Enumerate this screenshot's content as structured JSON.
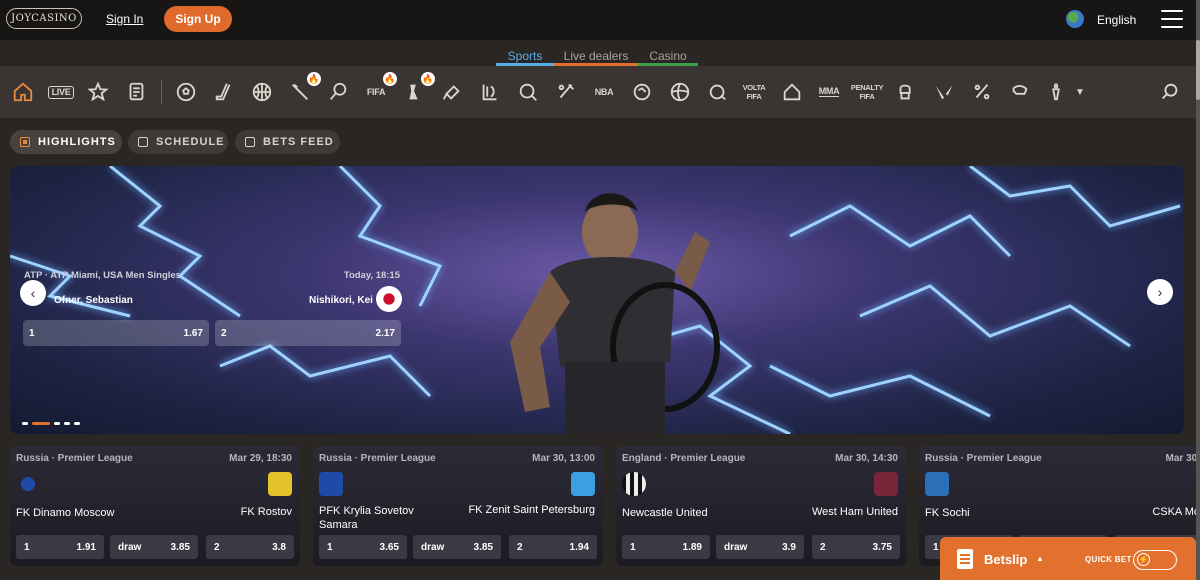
{
  "header": {
    "logo_text": "JOYCASINO",
    "signin_label": "Sign In",
    "signup_label": "Sign Up",
    "language": "English"
  },
  "nav_tabs": [
    {
      "label": "Sports",
      "active": true,
      "color": "#5aaee6"
    },
    {
      "label": "Live dealers",
      "active": false,
      "color": "#e0702c"
    },
    {
      "label": "Casino",
      "active": false,
      "color": "#3aa04a"
    }
  ],
  "sports_icons": {
    "live": "LIVE",
    "fifa1": "FIFA",
    "nba": "NBA",
    "volta": "VOLTA FIFA",
    "mma": "MMA",
    "penalty": "PENALTY FIFA"
  },
  "filters": [
    {
      "label": "HIGHLIGHTS",
      "active": true
    },
    {
      "label": "SCHEDULE",
      "active": false
    },
    {
      "label": "BETS FEED",
      "active": false
    }
  ],
  "featured": {
    "tournament": "ATP · ATP Miami, USA Men Singles",
    "time": "Today, 18:15",
    "player1": "Ofner, Sebastian",
    "player2": "Nishikori, Kei",
    "odd1_label": "1",
    "odd1_value": "1.67",
    "odd2_label": "2",
    "odd2_value": "2.17"
  },
  "matches": [
    {
      "league": "Russia · Premier League",
      "date": "Mar 29, 18:30",
      "team1": "FK Dinamo Moscow",
      "team2": "FK Rostov",
      "odds": [
        {
          "l": "1",
          "v": "1.91"
        },
        {
          "l": "draw",
          "v": "3.85"
        },
        {
          "l": "2",
          "v": "3.8"
        }
      ]
    },
    {
      "league": "Russia · Premier League",
      "date": "Mar 30, 13:00",
      "team1": "PFK Krylia Sovetov Samara",
      "team2": "FK Zenit Saint Petersburg",
      "odds": [
        {
          "l": "1",
          "v": "3.65"
        },
        {
          "l": "draw",
          "v": "3.85"
        },
        {
          "l": "2",
          "v": "1.94"
        }
      ]
    },
    {
      "league": "England · Premier League",
      "date": "Mar 30, 14:30",
      "team1": "Newcastle United",
      "team2": "West Ham United",
      "odds": [
        {
          "l": "1",
          "v": "1.89"
        },
        {
          "l": "draw",
          "v": "3.9"
        },
        {
          "l": "2",
          "v": "3.75"
        }
      ]
    },
    {
      "league": "Russia · Premier League",
      "date": "Mar 30,",
      "team1": "FK Sochi",
      "team2": "CSKA Mo",
      "odds": [
        {
          "l": "1",
          "v": ""
        },
        {
          "l": "",
          "v": ""
        },
        {
          "l": "",
          "v": ""
        }
      ]
    }
  ],
  "betslip": {
    "label": "Betslip",
    "quickbet_label": "QUICK BET"
  },
  "colors": {
    "accent": "#e0702c",
    "sports_tab": "#5aaee6",
    "live_tab": "#e0702c",
    "casino_tab": "#3aa04a"
  }
}
